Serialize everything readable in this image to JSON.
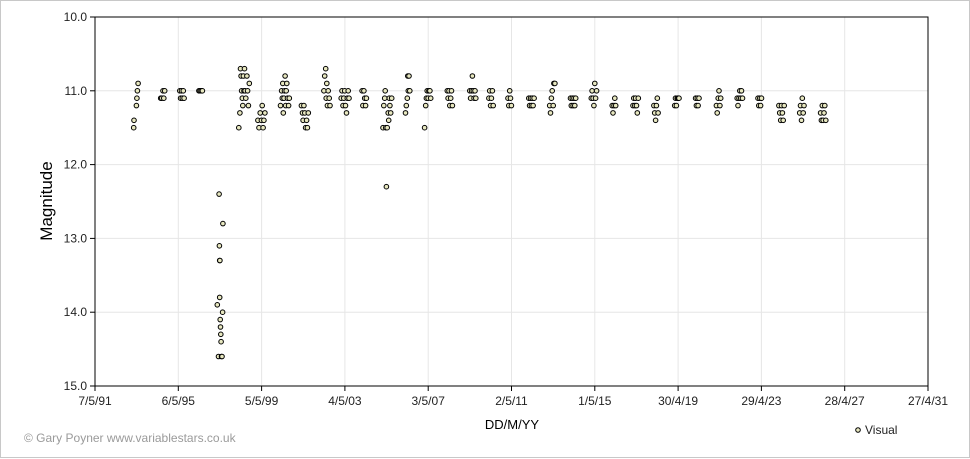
{
  "credit": "© Gary Poyner  www.variablestars.co.uk",
  "chart_data": {
    "type": "scatter",
    "title": "",
    "xlabel": "DD/M/YY",
    "ylabel": "Magnitude",
    "x_axis": {
      "type": "date",
      "min": "1991-05-07",
      "max": "2031-04-27",
      "tick_labels": [
        "7/5/91",
        "6/5/95",
        "5/5/99",
        "4/5/03",
        "3/5/07",
        "2/5/11",
        "1/5/15",
        "30/4/19",
        "29/4/23",
        "28/4/27",
        "27/4/31"
      ]
    },
    "y_axis": {
      "min": 10.0,
      "max": 15.0,
      "inverted": true,
      "tick_labels": [
        "10.0",
        "11.0",
        "12.0",
        "13.0",
        "14.0",
        "15.0"
      ]
    },
    "grid": true,
    "legend_position": "bottom-right",
    "marker_color": "#000000",
    "marker_fill": "#e8e8c0",
    "series": [
      {
        "name": "Visual",
        "points": [
          [
            "1993-03-15",
            11.5
          ],
          [
            "1993-03-20",
            11.4
          ],
          [
            "1993-05-01",
            11.2
          ],
          [
            "1993-05-10",
            11.1
          ],
          [
            "1993-05-20",
            11.0
          ],
          [
            "1993-06-01",
            10.9
          ],
          [
            "1994-07-01",
            11.1
          ],
          [
            "1994-07-20",
            11.1
          ],
          [
            "1994-08-10",
            11.0
          ],
          [
            "1994-08-25",
            11.1
          ],
          [
            "1994-09-10",
            11.0
          ],
          [
            "1995-06-01",
            11.0
          ],
          [
            "1995-06-15",
            11.1
          ],
          [
            "1995-07-01",
            11.0
          ],
          [
            "1995-07-15",
            11.1
          ],
          [
            "1995-08-01",
            11.0
          ],
          [
            "1995-08-15",
            11.1
          ],
          [
            "1996-05-01",
            11.0
          ],
          [
            "1996-05-20",
            11.0
          ],
          [
            "1996-06-10",
            11.0
          ],
          [
            "1996-07-01",
            11.0
          ],
          [
            "1997-04-20",
            12.4
          ],
          [
            "1997-04-25",
            13.1
          ],
          [
            "1997-04-30",
            13.3
          ],
          [
            "1997-05-05",
            13.3
          ],
          [
            "1997-03-20",
            13.9
          ],
          [
            "1997-05-01",
            13.8
          ],
          [
            "1997-05-10",
            14.1
          ],
          [
            "1997-05-15",
            14.2
          ],
          [
            "1997-05-20",
            14.3
          ],
          [
            "1997-05-25",
            14.4
          ],
          [
            "1997-04-10",
            14.6
          ],
          [
            "1997-06-01",
            14.6
          ],
          [
            "1997-06-10",
            14.6
          ],
          [
            "1997-06-20",
            14.0
          ],
          [
            "1997-06-25",
            12.8
          ],
          [
            "1998-04-01",
            11.5
          ],
          [
            "1998-04-20",
            11.3
          ],
          [
            "1998-05-01",
            10.7
          ],
          [
            "1998-05-10",
            10.8
          ],
          [
            "1998-05-20",
            11.0
          ],
          [
            "1998-06-01",
            11.1
          ],
          [
            "1998-06-10",
            11.2
          ],
          [
            "1998-06-20",
            10.8
          ],
          [
            "1998-07-01",
            11.0
          ],
          [
            "1998-07-10",
            10.7
          ],
          [
            "1998-07-20",
            11.0
          ],
          [
            "1998-08-01",
            11.1
          ],
          [
            "1998-08-20",
            10.8
          ],
          [
            "1998-09-01",
            11.0
          ],
          [
            "1998-09-15",
            11.2
          ],
          [
            "1998-10-01",
            10.9
          ],
          [
            "1999-03-01",
            11.4
          ],
          [
            "1999-03-20",
            11.5
          ],
          [
            "1999-04-10",
            11.3
          ],
          [
            "1999-05-01",
            11.4
          ],
          [
            "1999-05-15",
            11.2
          ],
          [
            "1999-06-01",
            11.5
          ],
          [
            "1999-06-15",
            11.4
          ],
          [
            "1999-07-01",
            11.3
          ],
          [
            "2000-04-01",
            11.2
          ],
          [
            "2000-04-20",
            11.0
          ],
          [
            "2000-05-01",
            11.1
          ],
          [
            "2000-05-10",
            10.9
          ],
          [
            "2000-05-20",
            11.3
          ],
          [
            "2000-06-01",
            11.1
          ],
          [
            "2000-06-10",
            11.0
          ],
          [
            "2000-06-20",
            10.8
          ],
          [
            "2000-07-01",
            11.2
          ],
          [
            "2000-07-10",
            11.0
          ],
          [
            "2000-07-20",
            10.9
          ],
          [
            "2000-08-01",
            11.1
          ],
          [
            "2000-08-20",
            11.2
          ],
          [
            "2000-09-01",
            11.1
          ],
          [
            "2001-04-01",
            11.2
          ],
          [
            "2001-04-20",
            11.3
          ],
          [
            "2001-05-01",
            11.4
          ],
          [
            "2001-05-15",
            11.2
          ],
          [
            "2001-06-01",
            11.3
          ],
          [
            "2001-06-15",
            11.5
          ],
          [
            "2001-07-01",
            11.4
          ],
          [
            "2001-07-15",
            11.5
          ],
          [
            "2001-08-01",
            11.3
          ],
          [
            "2002-05-01",
            11.0
          ],
          [
            "2002-05-15",
            10.8
          ],
          [
            "2002-06-01",
            10.7
          ],
          [
            "2002-06-10",
            11.1
          ],
          [
            "2002-06-20",
            10.9
          ],
          [
            "2002-07-01",
            11.2
          ],
          [
            "2002-07-15",
            11.0
          ],
          [
            "2002-08-01",
            11.1
          ],
          [
            "2002-08-15",
            11.2
          ],
          [
            "2003-03-01",
            11.1
          ],
          [
            "2003-03-15",
            11.0
          ],
          [
            "2003-04-01",
            11.2
          ],
          [
            "2003-04-15",
            11.1
          ],
          [
            "2003-05-01",
            11.0
          ],
          [
            "2003-05-15",
            11.2
          ],
          [
            "2003-06-01",
            11.3
          ],
          [
            "2003-06-15",
            11.1
          ],
          [
            "2003-07-01",
            11.0
          ],
          [
            "2003-07-15",
            11.1
          ],
          [
            "2004-03-01",
            11.0
          ],
          [
            "2004-03-15",
            11.2
          ],
          [
            "2004-04-01",
            11.0
          ],
          [
            "2004-04-15",
            11.1
          ],
          [
            "2004-05-01",
            11.2
          ],
          [
            "2004-05-15",
            11.1
          ],
          [
            "2005-03-01",
            11.5
          ],
          [
            "2005-03-15",
            11.2
          ],
          [
            "2005-04-01",
            11.1
          ],
          [
            "2005-04-10",
            11.0
          ],
          [
            "2005-04-20",
            11.5
          ],
          [
            "2005-05-01",
            12.3
          ],
          [
            "2005-05-15",
            11.5
          ],
          [
            "2005-06-01",
            11.3
          ],
          [
            "2005-06-10",
            11.4
          ],
          [
            "2005-06-20",
            11.1
          ],
          [
            "2005-07-01",
            11.2
          ],
          [
            "2005-07-15",
            11.3
          ],
          [
            "2005-08-01",
            11.1
          ],
          [
            "2006-04-01",
            11.3
          ],
          [
            "2006-04-15",
            11.2
          ],
          [
            "2006-05-01",
            11.1
          ],
          [
            "2006-05-10",
            10.8
          ],
          [
            "2006-05-20",
            11.0
          ],
          [
            "2006-06-01",
            10.8
          ],
          [
            "2006-06-15",
            11.0
          ],
          [
            "2007-03-01",
            11.5
          ],
          [
            "2007-03-20",
            11.2
          ],
          [
            "2007-04-01",
            11.1
          ],
          [
            "2007-04-15",
            11.0
          ],
          [
            "2007-05-01",
            11.1
          ],
          [
            "2007-05-15",
            11.0
          ],
          [
            "2007-06-01",
            11.0
          ],
          [
            "2007-06-15",
            11.1
          ],
          [
            "2008-04-01",
            11.0
          ],
          [
            "2008-04-15",
            11.1
          ],
          [
            "2008-05-01",
            11.0
          ],
          [
            "2008-05-15",
            11.2
          ],
          [
            "2008-06-01",
            11.1
          ],
          [
            "2008-06-15",
            11.0
          ],
          [
            "2008-07-01",
            11.2
          ],
          [
            "2009-05-01",
            11.0
          ],
          [
            "2009-05-15",
            11.1
          ],
          [
            "2009-06-01",
            11.0
          ],
          [
            "2009-06-15",
            10.8
          ],
          [
            "2009-07-01",
            11.0
          ],
          [
            "2009-07-15",
            11.1
          ],
          [
            "2009-08-01",
            11.0
          ],
          [
            "2009-08-15",
            11.1
          ],
          [
            "2010-04-01",
            11.1
          ],
          [
            "2010-04-15",
            11.0
          ],
          [
            "2010-05-01",
            11.2
          ],
          [
            "2010-05-15",
            11.1
          ],
          [
            "2010-06-01",
            11.0
          ],
          [
            "2010-06-15",
            11.2
          ],
          [
            "2011-03-01",
            11.1
          ],
          [
            "2011-03-15",
            11.2
          ],
          [
            "2011-04-01",
            11.0
          ],
          [
            "2011-04-15",
            11.1
          ],
          [
            "2011-05-01",
            11.2
          ],
          [
            "2012-03-01",
            11.1
          ],
          [
            "2012-03-15",
            11.2
          ],
          [
            "2012-04-01",
            11.1
          ],
          [
            "2012-04-15",
            11.2
          ],
          [
            "2012-05-01",
            11.1
          ],
          [
            "2012-05-15",
            11.2
          ],
          [
            "2012-06-01",
            11.1
          ],
          [
            "2013-03-01",
            11.2
          ],
          [
            "2013-03-15",
            11.3
          ],
          [
            "2013-04-01",
            11.1
          ],
          [
            "2013-04-15",
            11.0
          ],
          [
            "2013-05-01",
            11.2
          ],
          [
            "2013-05-15",
            10.9
          ],
          [
            "2013-06-01",
            10.9
          ],
          [
            "2014-03-01",
            11.1
          ],
          [
            "2014-03-15",
            11.2
          ],
          [
            "2014-04-01",
            11.1
          ],
          [
            "2014-04-15",
            11.2
          ],
          [
            "2014-05-01",
            11.1
          ],
          [
            "2014-05-15",
            11.2
          ],
          [
            "2014-06-01",
            11.1
          ],
          [
            "2015-03-01",
            11.1
          ],
          [
            "2015-03-15",
            11.0
          ],
          [
            "2015-04-01",
            11.1
          ],
          [
            "2015-04-15",
            11.2
          ],
          [
            "2015-05-01",
            10.9
          ],
          [
            "2015-05-15",
            11.1
          ],
          [
            "2015-06-01",
            11.0
          ],
          [
            "2016-03-01",
            11.2
          ],
          [
            "2016-03-15",
            11.3
          ],
          [
            "2016-04-01",
            11.2
          ],
          [
            "2016-04-15",
            11.1
          ],
          [
            "2016-05-01",
            11.2
          ],
          [
            "2017-03-01",
            11.2
          ],
          [
            "2017-03-15",
            11.1
          ],
          [
            "2017-04-01",
            11.2
          ],
          [
            "2017-04-15",
            11.1
          ],
          [
            "2017-05-01",
            11.2
          ],
          [
            "2017-05-15",
            11.3
          ],
          [
            "2017-06-01",
            11.1
          ],
          [
            "2018-03-01",
            11.2
          ],
          [
            "2018-03-15",
            11.3
          ],
          [
            "2018-04-01",
            11.4
          ],
          [
            "2018-04-15",
            11.2
          ],
          [
            "2018-05-01",
            11.1
          ],
          [
            "2018-05-15",
            11.3
          ],
          [
            "2019-03-01",
            11.2
          ],
          [
            "2019-03-15",
            11.1
          ],
          [
            "2019-04-01",
            11.2
          ],
          [
            "2019-04-15",
            11.1
          ],
          [
            "2019-05-01",
            11.1
          ],
          [
            "2019-05-15",
            11.1
          ],
          [
            "2020-03-01",
            11.1
          ],
          [
            "2020-03-15",
            11.2
          ],
          [
            "2020-04-01",
            11.1
          ],
          [
            "2020-04-15",
            11.2
          ],
          [
            "2020-05-01",
            11.1
          ],
          [
            "2021-03-01",
            11.2
          ],
          [
            "2021-03-15",
            11.3
          ],
          [
            "2021-04-01",
            11.1
          ],
          [
            "2021-04-15",
            11.0
          ],
          [
            "2021-05-01",
            11.2
          ],
          [
            "2021-05-15",
            11.1
          ],
          [
            "2022-03-01",
            11.1
          ],
          [
            "2022-03-15",
            11.2
          ],
          [
            "2022-04-01",
            11.1
          ],
          [
            "2022-04-15",
            11.0
          ],
          [
            "2022-05-01",
            11.1
          ],
          [
            "2022-05-15",
            11.0
          ],
          [
            "2022-06-01",
            11.1
          ],
          [
            "2023-03-01",
            11.1
          ],
          [
            "2023-03-15",
            11.2
          ],
          [
            "2023-04-01",
            11.1
          ],
          [
            "2023-04-15",
            11.2
          ],
          [
            "2023-05-01",
            11.1
          ],
          [
            "2024-03-01",
            11.2
          ],
          [
            "2024-03-15",
            11.3
          ],
          [
            "2024-04-01",
            11.4
          ],
          [
            "2024-04-15",
            11.2
          ],
          [
            "2024-05-01",
            11.3
          ],
          [
            "2024-05-15",
            11.4
          ],
          [
            "2024-06-01",
            11.2
          ],
          [
            "2025-03-01",
            11.3
          ],
          [
            "2025-03-15",
            11.2
          ],
          [
            "2025-04-01",
            11.4
          ],
          [
            "2025-04-15",
            11.1
          ],
          [
            "2025-05-01",
            11.3
          ],
          [
            "2025-05-15",
            11.2
          ],
          [
            "2026-03-01",
            11.3
          ],
          [
            "2026-03-15",
            11.4
          ],
          [
            "2026-04-01",
            11.2
          ],
          [
            "2026-04-15",
            11.4
          ],
          [
            "2026-05-01",
            11.3
          ],
          [
            "2026-05-15",
            11.2
          ],
          [
            "2026-06-01",
            11.4
          ]
        ]
      }
    ]
  }
}
